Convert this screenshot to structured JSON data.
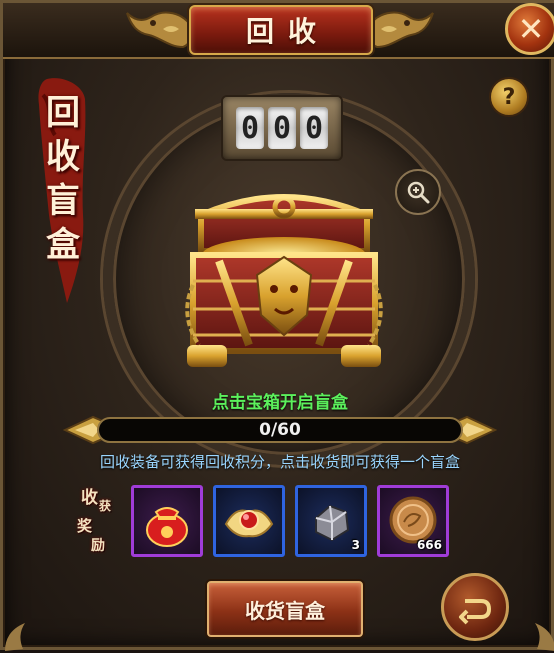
{
  "window": {
    "title": "回收",
    "close_icon": "close-icon",
    "help_icon": "question-icon"
  },
  "banner": {
    "lines": [
      "回",
      "收",
      "盲",
      "盒"
    ]
  },
  "counter": {
    "digits": [
      "0",
      "0",
      "0"
    ]
  },
  "zoom": {
    "icon": "magnifier-plus-icon"
  },
  "chest": {
    "icon": "treasure-chest-icon",
    "hint": "点击宝箱开启盲盒"
  },
  "progress": {
    "text": "0/60",
    "current": 0,
    "max": 60
  },
  "description": "回收装备可获得回收积分，点击收货即可获得一个盲盒",
  "rewards": {
    "label": [
      "收",
      "获",
      "奖",
      "励"
    ],
    "items": [
      {
        "icon": "red-lucky-bag-icon",
        "quality": "purple",
        "count": ""
      },
      {
        "icon": "red-gem-icon",
        "quality": "blue",
        "count": ""
      },
      {
        "icon": "ore-stone-icon",
        "quality": "blue",
        "count": "3"
      },
      {
        "icon": "gold-coin-icon",
        "quality": "purple",
        "count": "666"
      }
    ]
  },
  "actions": {
    "collect_label": "收货盲盒",
    "back_icon": "return-arrow-icon"
  },
  "colors": {
    "hint_green": "#5cf05c",
    "description_blue": "#9ad6ff",
    "purple_quality": "#a03cd8",
    "blue_quality": "#2f64e0",
    "title_red": "#b8321e"
  }
}
